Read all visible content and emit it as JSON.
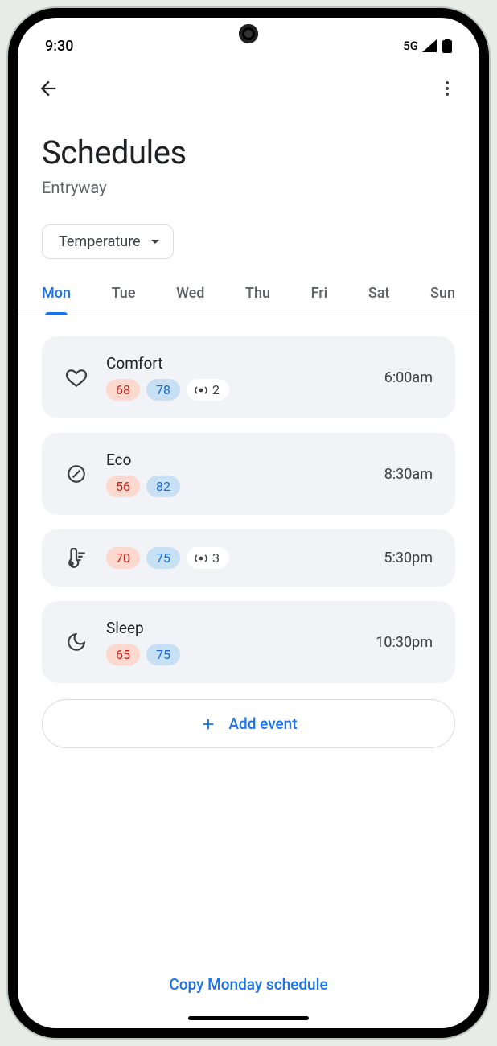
{
  "status": {
    "time": "9:30",
    "network": "5G"
  },
  "page": {
    "title": "Schedules",
    "subtitle": "Entryway",
    "dropdown_label": "Temperature",
    "add_event_label": "Add event",
    "copy_label": "Copy Monday schedule"
  },
  "tabs": [
    "Mon",
    "Tue",
    "Wed",
    "Thu",
    "Fri",
    "Sat",
    "Sun"
  ],
  "active_tab": 0,
  "events": [
    {
      "icon": "heart",
      "name": "Comfort",
      "heat": "68",
      "cool": "78",
      "sensor_count": "2",
      "time": "6:00am"
    },
    {
      "icon": "leaf",
      "name": "Eco",
      "heat": "56",
      "cool": "82",
      "sensor_count": null,
      "time": "8:30am"
    },
    {
      "icon": "thermo",
      "name": "",
      "heat": "70",
      "cool": "75",
      "sensor_count": "3",
      "time": "5:30pm"
    },
    {
      "icon": "moon",
      "name": "Sleep",
      "heat": "65",
      "cool": "75",
      "sensor_count": null,
      "time": "10:30pm"
    }
  ]
}
